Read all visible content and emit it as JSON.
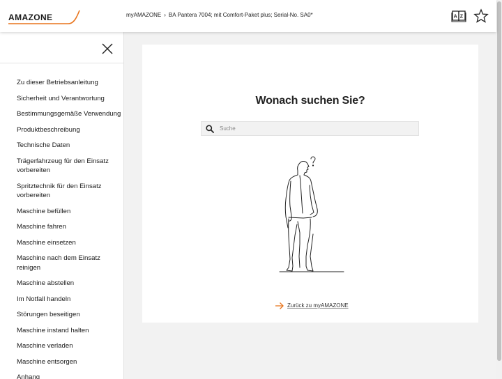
{
  "header": {
    "logo_text": "AMAZONE",
    "breadcrumb": {
      "root": "myAMAZONE",
      "separator": "›",
      "current": "BA Pantera 7004; mit Comfort-Paket plus; Serial-No. SA0*"
    },
    "icons": [
      "dictionary-book-icon",
      "star-favorite-icon"
    ]
  },
  "sidebar": {
    "close_icon": "close-icon",
    "items": [
      {
        "label": "Zu dieser Betriebsanleitung"
      },
      {
        "label": "Sicherheit und Verantwortung"
      },
      {
        "label": "Bestimmungsgemäße Verwendung"
      },
      {
        "label": "Produktbeschreibung"
      },
      {
        "label": "Technische Daten"
      },
      {
        "label": "Trägerfahrzeug für den Einsatz vorbereiten"
      },
      {
        "label": "Spritztechnik für den Einsatz vorbereiten"
      },
      {
        "label": "Maschine befüllen"
      },
      {
        "label": "Maschine fahren"
      },
      {
        "label": "Maschine einsetzen"
      },
      {
        "label": "Maschine nach dem Einsatz reinigen"
      },
      {
        "label": "Maschine abstellen"
      },
      {
        "label": "Im Notfall handeln"
      },
      {
        "label": "Störungen beseitigen"
      },
      {
        "label": "Maschine instand halten"
      },
      {
        "label": "Maschine verladen"
      },
      {
        "label": "Maschine entsorgen"
      },
      {
        "label": "Anhang"
      }
    ]
  },
  "main": {
    "title": "Wonach suchen Sie?",
    "search": {
      "placeholder": "Suche",
      "value": ""
    },
    "illustration": "thinking-person-illustration",
    "back_link": "Zurück zu myAMAZONE"
  },
  "colors": {
    "accent": "#e8731b",
    "text": "#222222",
    "background": "#f2f2f2"
  }
}
